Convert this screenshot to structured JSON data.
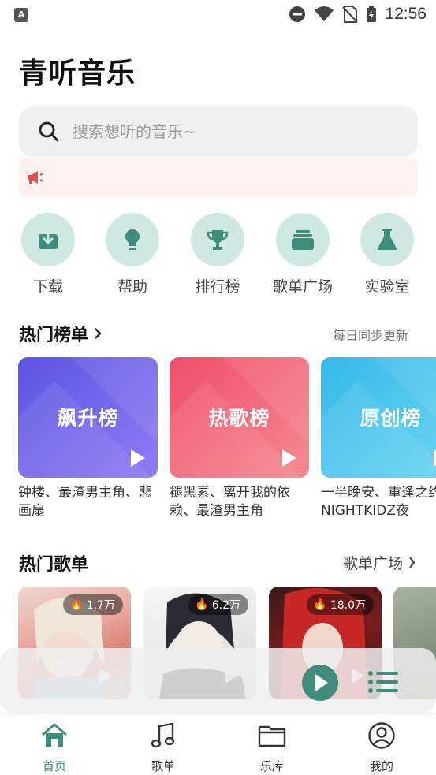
{
  "status_bar": {
    "time": "12:56",
    "app_badge": "A"
  },
  "page": {
    "title": "青听音乐"
  },
  "search": {
    "placeholder": "搜索想听的音乐~"
  },
  "quick_actions": [
    {
      "label": "下载",
      "icon": "download-icon"
    },
    {
      "label": "帮助",
      "icon": "lightbulb-icon"
    },
    {
      "label": "排行榜",
      "icon": "trophy-icon"
    },
    {
      "label": "歌单广场",
      "icon": "album-stack-icon"
    },
    {
      "label": "实验室",
      "icon": "flask-icon"
    }
  ],
  "hot_charts": {
    "title": "热门榜单",
    "aside": "每日同步更新",
    "items": [
      {
        "name": "飙升榜",
        "desc": "钟楼、最渣男主角、悲画扇",
        "color_from": "#5b55e0",
        "color_to": "#8f7cf5"
      },
      {
        "name": "热歌榜",
        "desc": "褪黑素、离开我的依赖、最渣男主角",
        "color_from": "#ef4e6a",
        "color_to": "#f58a8f"
      },
      {
        "name": "原创榜",
        "desc": "一半晚安、重逢之约、NIGHTKIDZ夜",
        "color_from": "#36b8e8",
        "color_to": "#6dd6f3"
      }
    ]
  },
  "hot_playlists": {
    "title": "热门歌单",
    "link": "歌单广场",
    "items": [
      {
        "count": "1.7万"
      },
      {
        "count": "6.2万"
      },
      {
        "count": "18.0万"
      }
    ]
  },
  "bottom_nav": [
    {
      "label": "首页",
      "active": true
    },
    {
      "label": "歌单",
      "active": false
    },
    {
      "label": "乐库",
      "active": false
    },
    {
      "label": "我的",
      "active": false
    }
  ],
  "colors": {
    "accent": "#3f8c7d",
    "icon_bg": "#cfe9e2",
    "notice_bg": "#fdf1f1"
  }
}
